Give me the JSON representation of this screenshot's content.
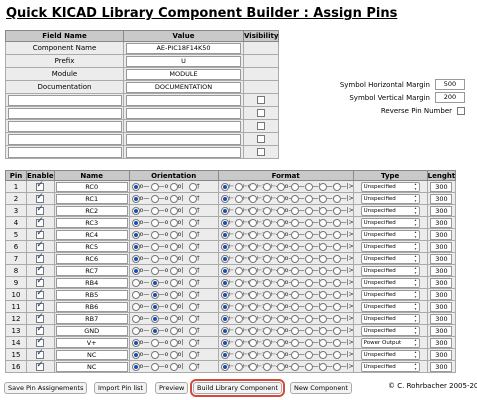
{
  "title": "Quick KICAD Library Component Builder : Assign Pins",
  "fields_table": {
    "headers": [
      "Field Name",
      "Value",
      "Visibility"
    ],
    "rows": [
      {
        "label": "Component Name",
        "value": "AE-PIC18F14K50"
      },
      {
        "label": "Prefix",
        "value": "U"
      },
      {
        "label": "Module",
        "value": "MODULE"
      },
      {
        "label": "Documentation",
        "value": "DOCUMENTATION"
      }
    ],
    "empty_rows": 5
  },
  "margins": {
    "horizontal_label": "Symbol Horizontal Margin",
    "horizontal_value": "500",
    "vertical_label": "Symbol Vertical Margin",
    "vertical_value": "200",
    "reverse_label": "Reverse Pin Number",
    "reverse_checked": false
  },
  "pins_table": {
    "headers": [
      "Pin",
      "Enable",
      "Name",
      "Orientation",
      "Format",
      "Type",
      "Lenght"
    ],
    "rows": [
      {
        "pin": "1",
        "name": "RC0",
        "orientation": 0,
        "type": "Unspecified",
        "length": "300"
      },
      {
        "pin": "2",
        "name": "RC1",
        "orientation": 0,
        "type": "Unspecified",
        "length": "300"
      },
      {
        "pin": "3",
        "name": "RC2",
        "orientation": 0,
        "type": "Unspecified",
        "length": "300"
      },
      {
        "pin": "4",
        "name": "RC3",
        "orientation": 0,
        "type": "Unspecified",
        "length": "300"
      },
      {
        "pin": "5",
        "name": "RC4",
        "orientation": 0,
        "type": "Unspecified",
        "length": "300"
      },
      {
        "pin": "6",
        "name": "RC5",
        "orientation": 0,
        "type": "Unspecified",
        "length": "300"
      },
      {
        "pin": "7",
        "name": "RC6",
        "orientation": 0,
        "type": "Unspecified",
        "length": "300"
      },
      {
        "pin": "8",
        "name": "RC7",
        "orientation": 0,
        "type": "Unspecified",
        "length": "300"
      },
      {
        "pin": "9",
        "name": "RB4",
        "orientation": 1,
        "type": "Unspecified",
        "length": "300"
      },
      {
        "pin": "10",
        "name": "RB5",
        "orientation": 1,
        "type": "Unspecified",
        "length": "300"
      },
      {
        "pin": "11",
        "name": "RB6",
        "orientation": 1,
        "type": "Unspecified",
        "length": "300"
      },
      {
        "pin": "12",
        "name": "RB7",
        "orientation": 1,
        "type": "Unspecified",
        "length": "300"
      },
      {
        "pin": "13",
        "name": "GND",
        "orientation": 1,
        "type": "Unspecified",
        "length": "300"
      },
      {
        "pin": "14",
        "name": "V+",
        "orientation": 0,
        "type": "Power Output",
        "length": "300"
      },
      {
        "pin": "15",
        "name": "NC",
        "orientation": 0,
        "type": "Unspecified",
        "length": "300"
      },
      {
        "pin": "16",
        "name": "NC",
        "orientation": 0,
        "type": "Unspecified",
        "length": "300"
      }
    ]
  },
  "orientation_glyphs": [
    "o—",
    "—o",
    "o|",
    "†"
  ],
  "format_glyphs": [
    "⊢",
    "⊢o",
    "⊢>",
    "⊢◁",
    "o—",
    "—<",
    "—|",
    "—⊕",
    "—|>"
  ],
  "buttons": {
    "save": "Save Pin Assignements",
    "import": "Import Pin list",
    "preview": "Preview",
    "build": "Build Library Component",
    "new": "New Component"
  },
  "copyright": "© C. Rohrbacher 2005-2015",
  "colors": {
    "highlight": "#d34a3a",
    "header_bg": "#c9c9c9",
    "table_bg": "#ececec",
    "radio_on": "#1a4fb0"
  }
}
